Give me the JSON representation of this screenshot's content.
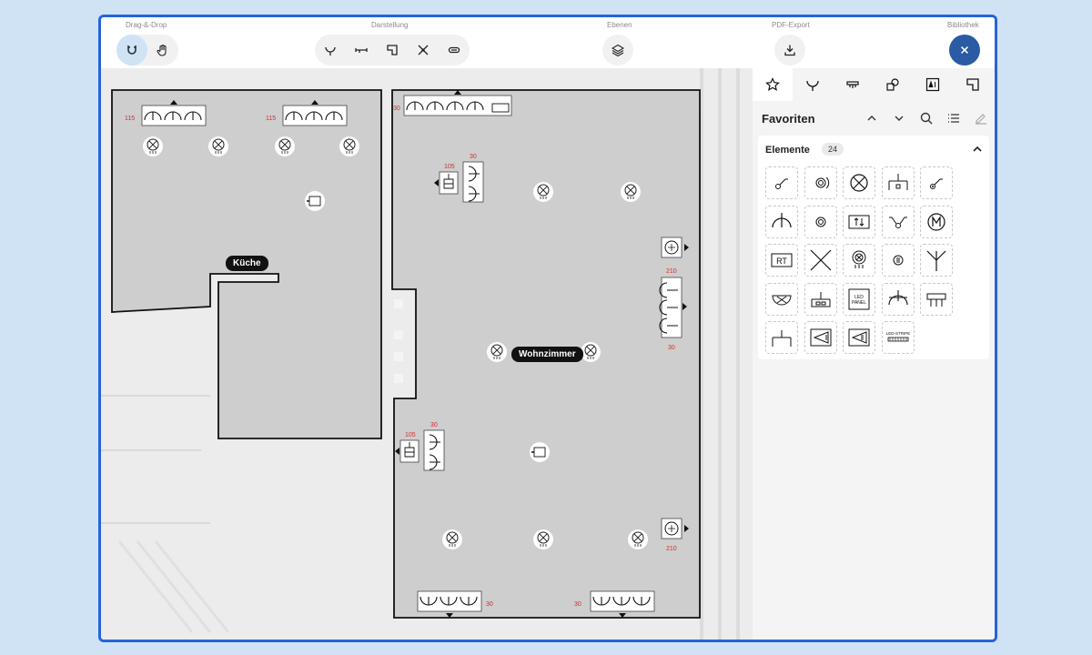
{
  "toolbar": {
    "groups": [
      {
        "label": "Drag-&-Drop"
      },
      {
        "label": "Darstellung"
      },
      {
        "label": "Ebenen"
      },
      {
        "label": "PDF-Export"
      },
      {
        "label": "Bibliothek"
      }
    ]
  },
  "canvas": {
    "rooms": [
      {
        "label": "Küche"
      },
      {
        "label": "Wohnzimmer"
      }
    ],
    "dim_labels": [
      "115",
      "115",
      "30",
      "30",
      "105",
      "210",
      "30",
      "105",
      "30",
      "210",
      "30",
      "30"
    ]
  },
  "sidebar": {
    "title": "Favoriten",
    "section_title": "Elemente",
    "count": "24",
    "elements": [
      "switch-icon",
      "dimmer-icon",
      "lamp-icon",
      "socket-double-icon",
      "switch-icon",
      "antenna-icon",
      "pushbutton-icon",
      "shutter-switch-icon",
      "switch-two-way-icon",
      "motor-icon",
      "thermostat-icon",
      "cross-icon",
      "ceiling-light-icon",
      "rotary-switch-icon",
      "antenna-socket-icon",
      "wall-light-icon",
      "socket-box-icon",
      "led-panel-icon",
      "single-socket-icon",
      "bracket-socket-icon",
      "socket-base-icon",
      "spot-icon",
      "spot-icon",
      "led-strip-icon"
    ],
    "led_panel_text": "LED PANEL",
    "led_strip_text": "LED-STRIPE"
  },
  "colors": {
    "accent": "#2563d9",
    "close": "#2a5ba4",
    "dim": "#d32f2f"
  }
}
